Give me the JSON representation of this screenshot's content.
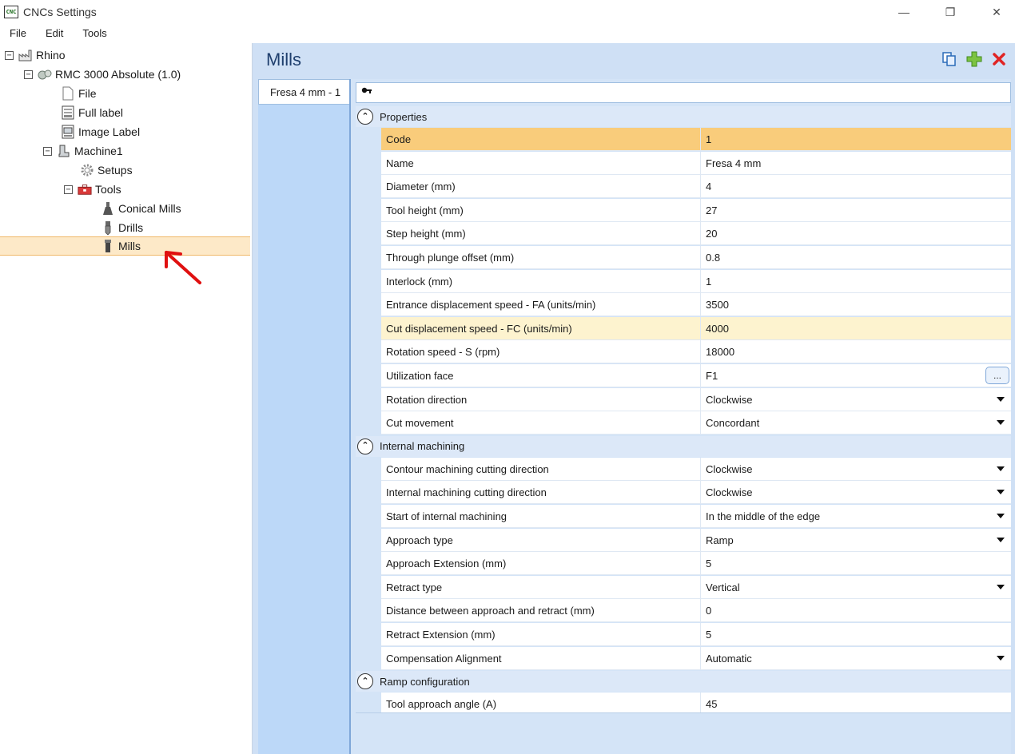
{
  "window": {
    "title": "CNCs Settings",
    "app_icon_text": "CNC",
    "controls": {
      "minimize": "—",
      "maximize": "❐",
      "close": "✕"
    }
  },
  "menu": [
    "File",
    "Edit",
    "Tools"
  ],
  "tree": {
    "rhino": "Rhino",
    "machine_group": "RMC 3000 Absolute (1.0)",
    "file": "File",
    "full_label": "Full label",
    "image_label": "Image Label",
    "machine1": "Machine1",
    "setups": "Setups",
    "tools": "Tools",
    "conical_mills": "Conical Mills",
    "drills": "Drills",
    "mills": "Mills",
    "expander_symbol": "⊟"
  },
  "page": {
    "title": "Mills"
  },
  "tabs": [
    "Fresa 4 mm - 1"
  ],
  "search": {
    "icon": "🔑"
  },
  "sections": {
    "properties": {
      "title": "Properties",
      "rows": [
        {
          "name": "Code",
          "value": "1"
        },
        {
          "name": "Name",
          "value": "Fresa 4 mm"
        },
        {
          "name": "Diameter (mm)",
          "value": "4"
        },
        {
          "name": "Tool height (mm)",
          "value": "27"
        },
        {
          "name": "Step height (mm)",
          "value": "20"
        },
        {
          "name": "Through plunge offset (mm)",
          "value": "0.8"
        },
        {
          "name": "Interlock (mm)",
          "value": "1"
        },
        {
          "name": "Entrance displacement speed - FA (units/min)",
          "value": "3500"
        },
        {
          "name": "Cut displacement speed - FC (units/min)",
          "value": "4000"
        },
        {
          "name": "Rotation speed - S (rpm)",
          "value": "18000"
        },
        {
          "name": "Utilization face",
          "value": "F1"
        },
        {
          "name": "Rotation direction",
          "value": "Clockwise"
        },
        {
          "name": "Cut movement",
          "value": "Concordant"
        }
      ]
    },
    "internal": {
      "title": "Internal machining",
      "rows": [
        {
          "name": "Contour machining cutting direction",
          "value": "Clockwise"
        },
        {
          "name": "Internal machining cutting direction",
          "value": "Clockwise"
        },
        {
          "name": "Start of internal machining",
          "value": "In the middle of the edge"
        },
        {
          "name": "Approach type",
          "value": "Ramp"
        },
        {
          "name": "Approach Extension (mm)",
          "value": "5"
        },
        {
          "name": "Retract type",
          "value": "Vertical"
        },
        {
          "name": "Distance between approach and retract (mm)",
          "value": "0"
        },
        {
          "name": "Retract Extension (mm)",
          "value": "5"
        },
        {
          "name": "Compensation Alignment",
          "value": "Automatic"
        }
      ]
    },
    "ramp": {
      "title": "Ramp configuration",
      "rows": [
        {
          "name": "Tool approach angle (A)",
          "value": "45"
        }
      ]
    }
  },
  "ellipsis_label": "...",
  "collapse_symbol": "⌃"
}
